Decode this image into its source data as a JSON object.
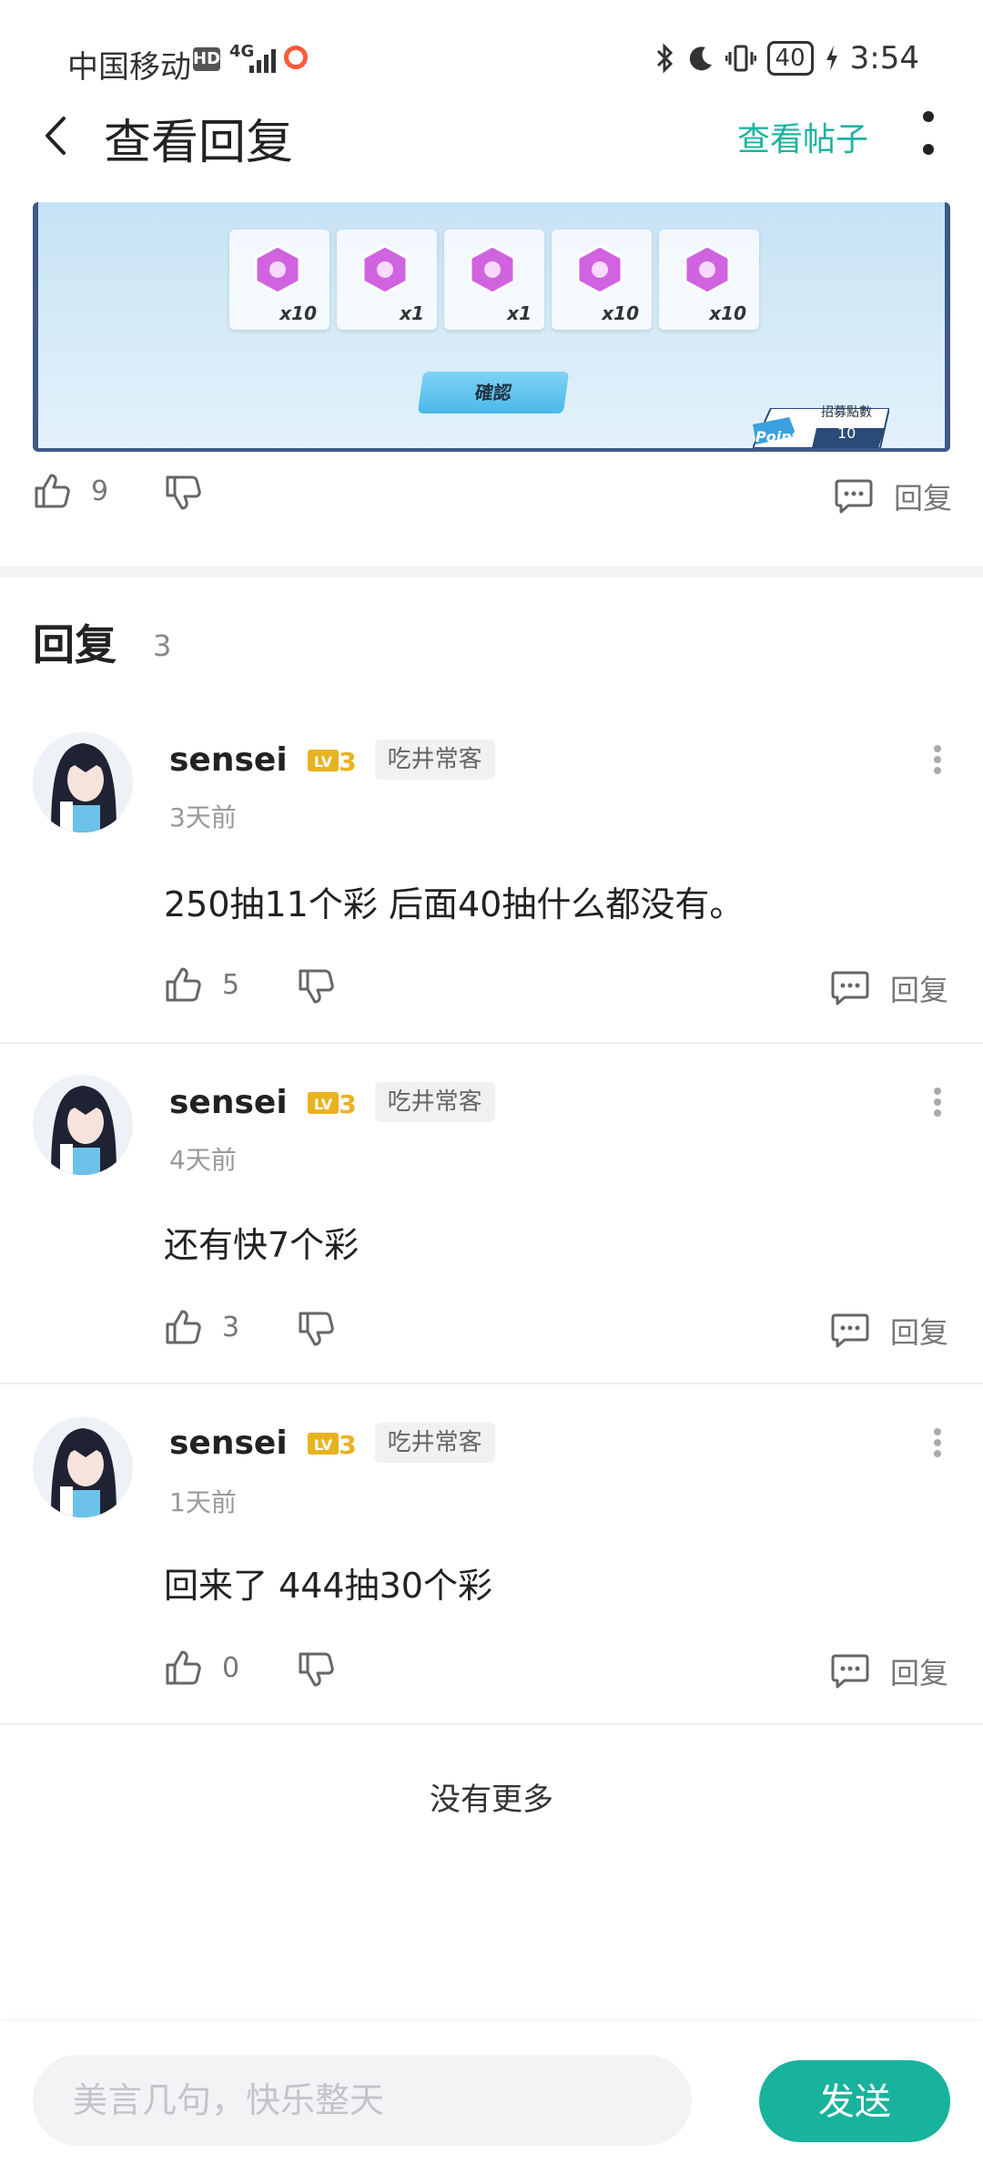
{
  "status_bar": {
    "carrier": "中国移动",
    "hd": "HD",
    "network": "4G",
    "battery": "40",
    "time": "3:54"
  },
  "header": {
    "title": "查看回复",
    "view_post": "查看帖子"
  },
  "post_image": {
    "reward_quantities": [
      "x10",
      "x1",
      "x1",
      "x10",
      "x10"
    ],
    "confirm": "確認",
    "point_title": "招募點數",
    "point_word": "Point",
    "point_value": "10"
  },
  "post_actions": {
    "likes": "9",
    "reply": "回复"
  },
  "replies_section": {
    "title": "回复",
    "count": "3"
  },
  "comments": [
    {
      "username": "sensei",
      "level": "LV3",
      "tag": "吃井常客",
      "time": "3天前",
      "content": "250抽11个彩 后面40抽什么都没有。",
      "likes": "5",
      "reply": "回复"
    },
    {
      "username": "sensei",
      "level": "LV3",
      "tag": "吃井常客",
      "time": "4天前",
      "content": "还有快7个彩",
      "likes": "3",
      "reply": "回复"
    },
    {
      "username": "sensei",
      "level": "LV3",
      "tag": "吃井常客",
      "time": "1天前",
      "content": "回来了 444抽30个彩",
      "likes": "0",
      "reply": "回复"
    }
  ],
  "footer": {
    "no_more": "没有更多"
  },
  "composer": {
    "placeholder": "美言几句，快乐整天",
    "send": "发送"
  },
  "colors": {
    "accent": "#19b29d",
    "link": "#1db3a0"
  }
}
